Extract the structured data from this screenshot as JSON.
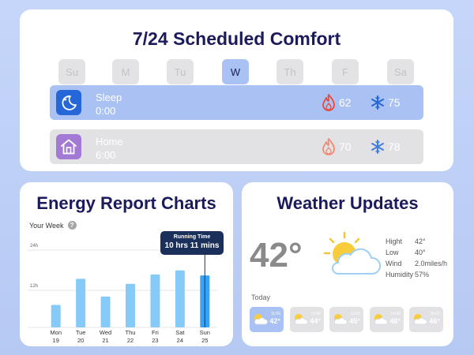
{
  "schedule": {
    "title": "7/24 Scheduled Comfort",
    "days": [
      {
        "label": "Su",
        "active": false
      },
      {
        "label": "M",
        "active": false
      },
      {
        "label": "Tu",
        "active": false
      },
      {
        "label": "W",
        "active": true
      },
      {
        "label": "Th",
        "active": false
      },
      {
        "label": "F",
        "active": false
      },
      {
        "label": "Sa",
        "active": false
      }
    ],
    "modes": [
      {
        "name": "Sleep",
        "time": "0:00",
        "icon": "moon-stars-icon",
        "heat": "62",
        "cool": "75",
        "heat_color": "#e8483b",
        "cool_color": "#2567d8"
      },
      {
        "name": "Home",
        "time": "6:00",
        "icon": "house-icon",
        "heat": "70",
        "cool": "78",
        "heat_color": "#ee8a73",
        "cool_color": "#3f7ee0"
      }
    ]
  },
  "energy": {
    "title": "Energy Report Charts",
    "subtitle": "Your Week",
    "tooltip": {
      "label": "Running Time",
      "value": "10 hrs 11 mins"
    }
  },
  "chart_data": {
    "type": "bar",
    "categories": [
      "Mon",
      "Tue",
      "Wed",
      "Thu",
      "Fri",
      "Sat",
      "Sun"
    ],
    "dates": [
      "19",
      "20",
      "21",
      "22",
      "23",
      "24",
      "25"
    ],
    "values": [
      6.7,
      14.5,
      9.2,
      13.0,
      15.8,
      17.0,
      15.5
    ],
    "y_ticks": [
      {
        "value": 24,
        "label": "24h"
      },
      {
        "value": 12,
        "label": "12h"
      }
    ],
    "ylim": [
      0,
      24
    ],
    "highlight": "Sun",
    "bar_color": "#86cbf8",
    "highlight_color": "#3aa2f5",
    "grid": true
  },
  "weather": {
    "title": "Weather Updates",
    "current_temp": "42°",
    "icon": "partly-cloudy-icon",
    "stats": [
      {
        "label": "Hight",
        "value": "42°"
      },
      {
        "label": "Low",
        "value": "40°"
      },
      {
        "label": "Wind",
        "value": "2.0miles/h"
      },
      {
        "label": "Humidity",
        "value": "57%"
      }
    ],
    "today_label": "Today",
    "hourly": [
      {
        "time": "11:00",
        "temp": "42°",
        "active": true
      },
      {
        "time": "12:00",
        "temp": "44°",
        "active": false
      },
      {
        "time": "13:00",
        "temp": "45°",
        "active": false
      },
      {
        "time": "14:00",
        "temp": "46°",
        "active": false
      },
      {
        "time": "15:00",
        "temp": "46°",
        "active": false
      }
    ]
  }
}
